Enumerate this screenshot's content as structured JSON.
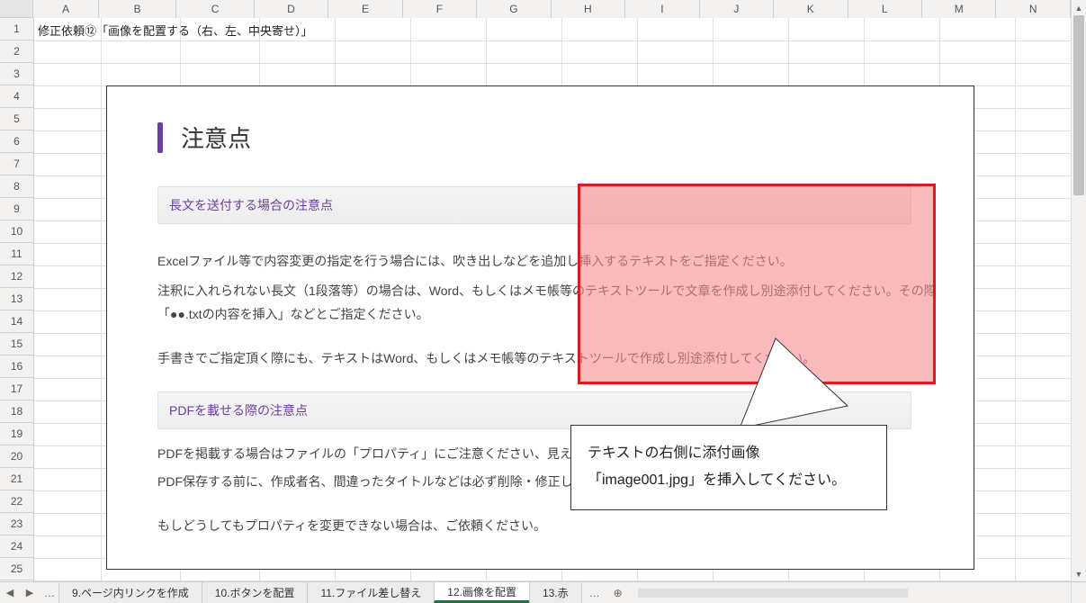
{
  "columns": {
    "labels": [
      "A",
      "B",
      "C",
      "D",
      "E",
      "F",
      "G",
      "H",
      "I",
      "J",
      "K",
      "L",
      "M",
      "N"
    ],
    "widths": [
      74,
      88,
      88,
      84,
      84,
      84,
      84,
      84,
      84,
      84,
      84,
      84,
      84,
      84
    ]
  },
  "rows": {
    "count": 25,
    "height": 25
  },
  "cells": {
    "A1": "修正依頼⑫「画像を配置する（右、左、中央寄せ）」"
  },
  "doc": {
    "heading": "注意点",
    "sub1": "長文を送付する場合の注意点",
    "p1": "Excelファイル等で内容変更の指定を行う場合には、吹き出しなどを追加し挿入するテキストをご指定ください。",
    "p2": "注釈に入れられない長文（1段落等）の場合は、Word、もしくはメモ帳等のテキストツールで文章を作成し別途添付してください。その際「●●.txtの内容を挿入」などとご指定ください。",
    "p3": "手書きでご指定頂く際にも、テキストはWord、もしくはメモ帳等のテキストツールで作成し別途添付してください。",
    "sub2": "PDFを載せる際の注意点",
    "p4": "PDFを掲載する場合はファイルの「プロパティ」にご注意ください、見えないファイルの情報が残っている場合があります。",
    "p5": "PDF保存する前に、作成者名、間違ったタイトルなどは必ず削除・修正してください。",
    "p6": "もしどうしてもプロパティを変更できない場合は、ご依頼ください。"
  },
  "callout": {
    "line1": "テキストの右側に添付画像",
    "line2": "「image001.jpg」を挿入してください。"
  },
  "tabs": {
    "items": [
      "9.ページ内リンクを作成",
      "10.ボタンを配置",
      "11.ファイル差し替え",
      "12.画像を配置",
      "13.赤"
    ],
    "active_index": 3
  },
  "icons": {
    "tab_prev": "◀",
    "tab_next": "▶",
    "dots": "…",
    "plus": "⊕",
    "up": "▲",
    "down": "▼"
  }
}
